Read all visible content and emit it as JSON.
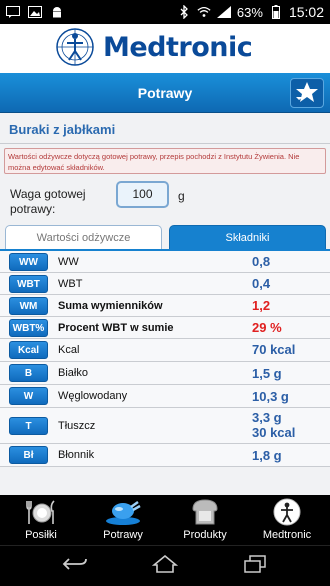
{
  "statusbar": {
    "battery": "63%",
    "time": "15:02"
  },
  "brand": {
    "name": "Medtronic"
  },
  "header": {
    "title": "Potrawy"
  },
  "dish": {
    "name": "Buraki z jabłkami"
  },
  "note": "Wartości odżywcze dotyczą gotowej potrawy, przepis pochodzi z Instytutu Żywienia. Nie można edytować składników.",
  "weight": {
    "label": "Waga gotowej potrawy:",
    "value": "100",
    "unit": "g"
  },
  "tabs": [
    {
      "label": "Wartości odżywcze"
    },
    {
      "label": "Składniki"
    }
  ],
  "nutrients": [
    {
      "badge": "WW",
      "label": "WW",
      "value": "0,8"
    },
    {
      "badge": "WBT",
      "label": "WBT",
      "value": "0,4"
    },
    {
      "badge": "WM",
      "label": "Suma wymienników",
      "value": "1,2"
    },
    {
      "badge": "WBT%",
      "label": "Procent WBT w sumie",
      "value": "29 %"
    },
    {
      "badge": "Kcal",
      "label": "Kcal",
      "value": "70 kcal"
    },
    {
      "badge": "B",
      "label": "Białko",
      "value": "1,5 g"
    },
    {
      "badge": "W",
      "label": "Węglowodany",
      "value": "10,3 g"
    },
    {
      "badge": "T",
      "label": "Tłuszcz",
      "value": "3,3 g",
      "value2": "30 kcal"
    },
    {
      "badge": "Bł",
      "label": "Błonnik",
      "value": "1,8 g"
    }
  ],
  "bottomnav": [
    {
      "label": "Posiłki"
    },
    {
      "label": "Potrawy"
    },
    {
      "label": "Produkty"
    },
    {
      "label": "Medtronic"
    }
  ],
  "colors": {
    "accent": "#1681cf",
    "brand": "#0a4a99",
    "warning": "#e02020",
    "value": "#2b5ea6"
  }
}
